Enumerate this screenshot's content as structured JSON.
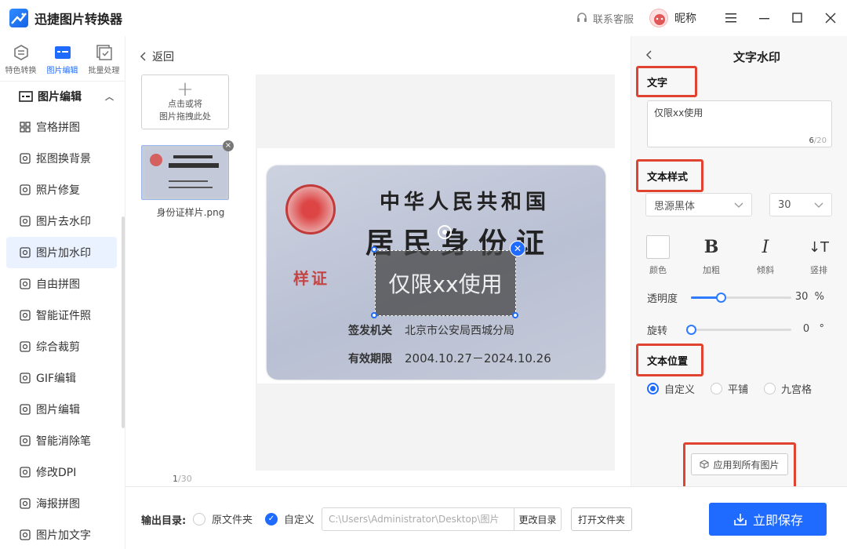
{
  "app": {
    "title": "迅捷图片转换器"
  },
  "header": {
    "support_label": "联系客服",
    "nickname": "昵称"
  },
  "modes": [
    {
      "label": "特色转换",
      "icon": "convert-icon"
    },
    {
      "label": "图片编辑",
      "icon": "image-edit-icon"
    },
    {
      "label": "批量处理",
      "icon": "batch-icon"
    }
  ],
  "sidebar": {
    "section_title": "图片编辑",
    "items": [
      {
        "label": "宫格拼图",
        "icon": "grid-icon"
      },
      {
        "label": "抠图换背景",
        "icon": "cutout-icon"
      },
      {
        "label": "照片修复",
        "icon": "photo-repair-icon"
      },
      {
        "label": "图片去水印",
        "icon": "remove-watermark-icon"
      },
      {
        "label": "图片加水印",
        "icon": "add-watermark-icon",
        "active": true
      },
      {
        "label": "自由拼图",
        "icon": "free-collage-icon"
      },
      {
        "label": "智能证件照",
        "icon": "id-photo-icon"
      },
      {
        "label": "综合裁剪",
        "icon": "crop-icon"
      },
      {
        "label": "GIF编辑",
        "icon": "gif-icon"
      },
      {
        "label": "图片编辑",
        "icon": "image-icon"
      },
      {
        "label": "智能消除笔",
        "icon": "eraser-pen-icon"
      },
      {
        "label": "修改DPI",
        "icon": "dpi-icon"
      },
      {
        "label": "海报拼图",
        "icon": "poster-icon"
      },
      {
        "label": "图片加文字",
        "icon": "add-text-icon"
      }
    ]
  },
  "middle": {
    "back_label": "返回",
    "dropzone_line1": "点击或将",
    "dropzone_line2": "图片拖拽此处",
    "thumb_name": "身份证样片.png",
    "page_current": "1",
    "page_total": "/30"
  },
  "card": {
    "line1": "中华人民共和国",
    "line2": "居民身份证",
    "stamp": "样证",
    "authority_key": "签发机关",
    "authority_val": "北京市公安局西城分局",
    "valid_key": "有效期限",
    "valid_val": "2004.10.27－2024.10.26"
  },
  "watermark_text": "仅限xx使用",
  "panel": {
    "title": "文字水印",
    "text_section": "文字",
    "text_value": "仅限xx使用",
    "count": "6",
    "count_max": "/20",
    "style_section": "文本样式",
    "font": "思源黑体",
    "size": "30",
    "style_buttons": [
      {
        "symbol": "",
        "label": "颜色"
      },
      {
        "symbol": "B",
        "label": "加粗"
      },
      {
        "symbol": "I",
        "label": "倾斜"
      },
      {
        "symbol": "↓T",
        "label": "竖排"
      }
    ],
    "opacity_label": "透明度",
    "opacity_value": "30",
    "opacity_unit": "%",
    "opacity_fraction": 0.3,
    "rotate_label": "旋转",
    "rotate_value": "0",
    "rotate_unit": "°",
    "rotate_fraction": 0,
    "position_section": "文本位置",
    "positions": [
      "自定义",
      "平铺",
      "九宫格"
    ],
    "apply_all": "应用到所有图片"
  },
  "bottom": {
    "output_label": "输出目录:",
    "opt_original": "原文件夹",
    "opt_custom": "自定义",
    "path": "C:\\Users\\Administrator\\Desktop\\图片",
    "change_dir": "更改目录",
    "open_folder": "打开文件夹",
    "save": "立即保存"
  },
  "colors": {
    "accent": "#1f6bff",
    "highlight": "#e0432f"
  }
}
